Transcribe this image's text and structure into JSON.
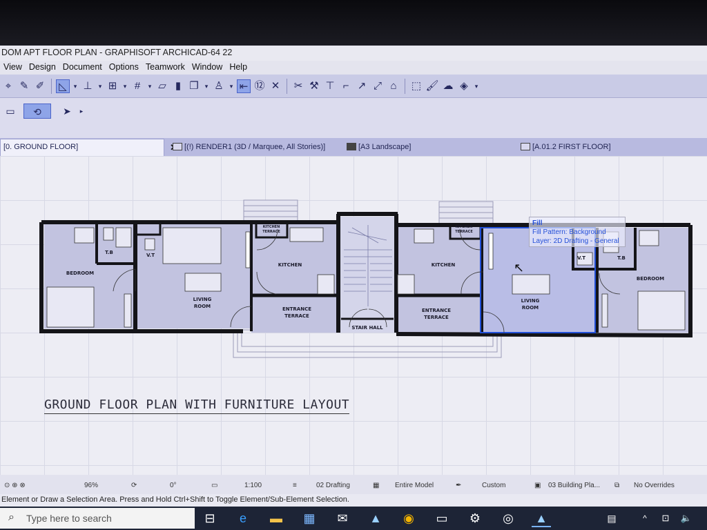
{
  "window": {
    "title": "DOM APT FLOOR PLAN - GRAPHISOFT ARCHICAD-64 22"
  },
  "menu": [
    "View",
    "Design",
    "Document",
    "Options",
    "Teamwork",
    "Window",
    "Help"
  ],
  "tabs": [
    {
      "label": "[0. GROUND FLOOR]",
      "active": true
    },
    {
      "label": "[(!) RENDER1 (3D / Marquee, All Stories)]"
    },
    {
      "label": "[A3 Landscape]"
    },
    {
      "label": "[A.01.2 FIRST FLOOR]"
    }
  ],
  "plan": {
    "title": "GROUND FLOOR PLAN WITH FURNITURE LAYOUT",
    "rooms": {
      "bedroom": "BEDROOM",
      "living_room_1": "LIVING",
      "living_room_2": "ROOM",
      "kitchen": "KITCHEN",
      "kitchen_terrace_1": "KITCHEN",
      "kitchen_terrace_2": "TERRACE",
      "entrance_terrace_1": "ENTRANCE",
      "entrance_terrace_2": "TERRACE",
      "stair_hall": "STAIR HALL",
      "tb": "T.B",
      "vt": "V.T"
    }
  },
  "tooltip": {
    "heading": "Fill",
    "fill_pattern": "Fill Pattern: Background",
    "layer": "Layer: 2D Drafting - General"
  },
  "status": {
    "zoom": "96%",
    "angle": "0°",
    "scale": "1:100",
    "layer_combo": "02 Drafting",
    "model_view": "Entire Model",
    "pen_set": "Custom",
    "mvo": "03 Building Pla...",
    "overrides": "No Overrides"
  },
  "hint": "Element or Draw a Selection Area. Press and Hold Ctrl+Shift to Toggle Element/Sub-Element Selection.",
  "taskbar": {
    "search_placeholder": "Type here to search"
  },
  "colors": {
    "room_fill": "#c2c3e0",
    "selection": "#2250d8",
    "toolbar": "#c9cbe6"
  }
}
